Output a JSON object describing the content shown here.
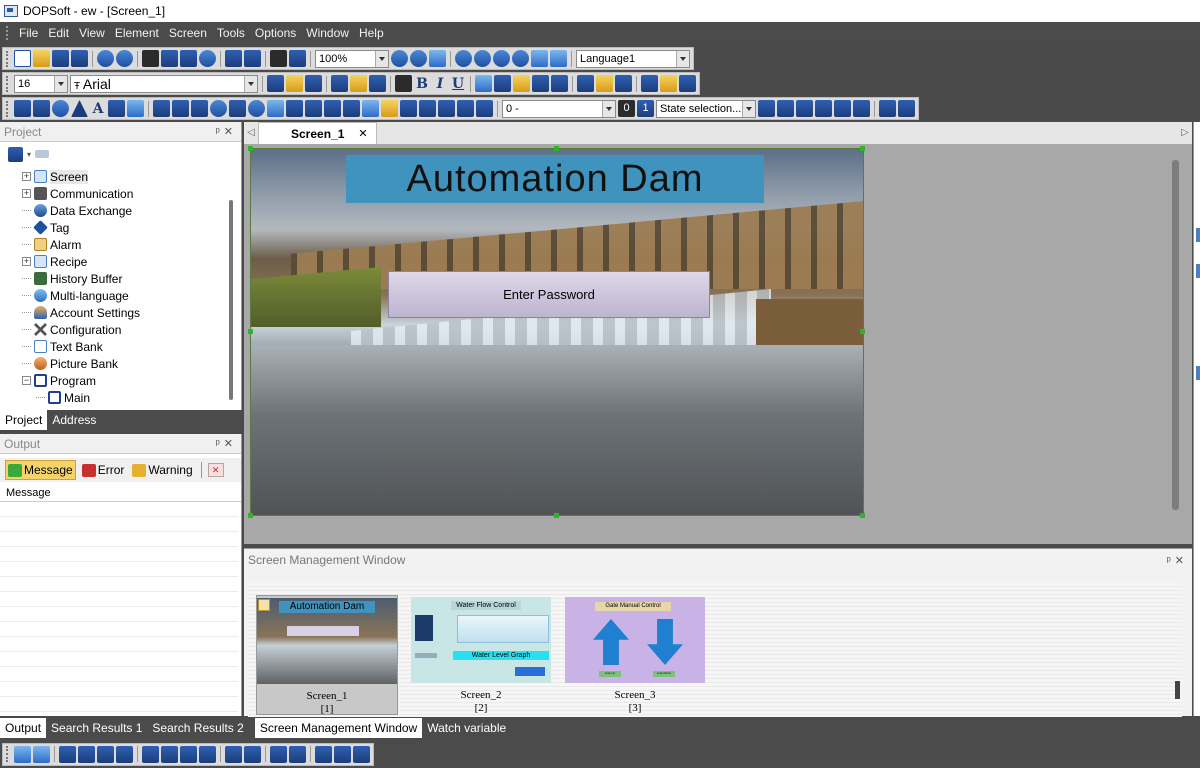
{
  "window": {
    "title": "DOPSoft - ew - [Screen_1]"
  },
  "menu": [
    "File",
    "Edit",
    "View",
    "Element",
    "Screen",
    "Tools",
    "Options",
    "Window",
    "Help"
  ],
  "toolbar": {
    "zoom": "100%",
    "language": "Language1",
    "font_size": "16",
    "font_name": "Arial",
    "state_value": "0 -",
    "state_selection": "State selection..."
  },
  "project_panel": {
    "title": "Project",
    "items": [
      {
        "label": "Screen",
        "expandable": true
      },
      {
        "label": "Communication",
        "expandable": true
      },
      {
        "label": "Data Exchange",
        "expandable": false
      },
      {
        "label": "Tag",
        "expandable": false
      },
      {
        "label": "Alarm",
        "expandable": false
      },
      {
        "label": "Recipe",
        "expandable": true
      },
      {
        "label": "History Buffer",
        "expandable": false
      },
      {
        "label": "Multi-language",
        "expandable": false
      },
      {
        "label": "Account Settings",
        "expandable": false
      },
      {
        "label": "Configuration",
        "expandable": false
      },
      {
        "label": "Text Bank",
        "expandable": false
      },
      {
        "label": "Picture Bank",
        "expandable": false
      },
      {
        "label": "Program",
        "expandable": true
      },
      {
        "label": "Main",
        "expandable": false
      }
    ],
    "tabs": [
      "Project",
      "Address"
    ]
  },
  "output_panel": {
    "title": "Output",
    "buttons": [
      "Message",
      "Error",
      "Warning"
    ],
    "column": "Message"
  },
  "editor": {
    "tab": "Screen_1",
    "screen_title": "Automation Dam",
    "button_label": "Enter Password"
  },
  "screen_management": {
    "title": "Screen Management Window",
    "screens": [
      {
        "name": "Screen_1",
        "index": "[1]",
        "thumb_title": "Automation Dam"
      },
      {
        "name": "Screen_2",
        "index": "[2]",
        "thumb_title": "Water Flow Control",
        "thumb_bar": "Water Level Graph"
      },
      {
        "name": "Screen_3",
        "index": "[3]",
        "thumb_title": "Gate Manual Control",
        "thumb_up": "Gate Up",
        "thumb_down": "Gate Down"
      }
    ]
  },
  "bottom_tabs": [
    "Output",
    "Search Results 1",
    "Search Results 2",
    "Screen Management Window",
    "Watch variable"
  ],
  "colors": {
    "title_bar_bg": "#3f93bd",
    "button_bg": "#ccc4dc",
    "app_chrome": "#4b4b4b"
  }
}
